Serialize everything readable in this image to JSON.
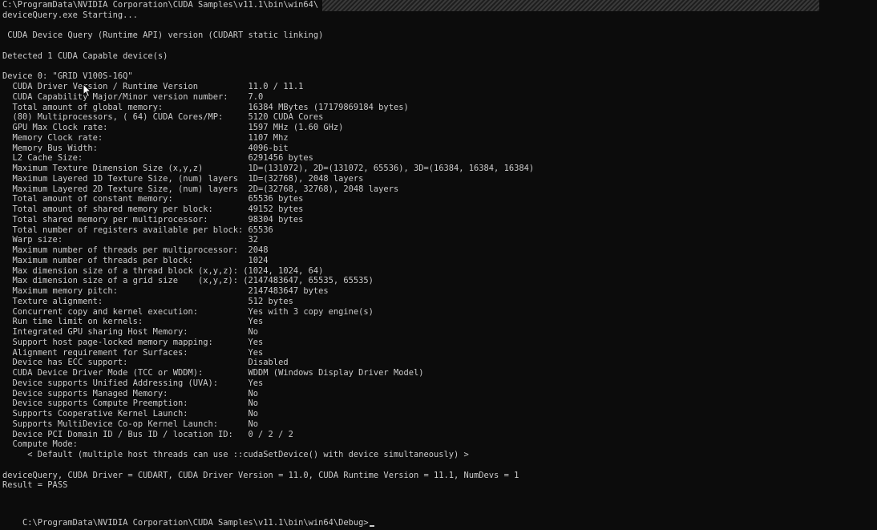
{
  "console": {
    "lines": [
      "C:\\ProgramData\\NVIDIA Corporation\\CUDA Samples\\v11.1\\bin\\win64\\",
      "deviceQuery.exe Starting...",
      "",
      " CUDA Device Query (Runtime API) version (CUDART static linking)",
      "",
      "Detected 1 CUDA Capable device(s)",
      "",
      "Device 0: \"GRID V100S-16Q\"",
      "  CUDA Driver Version / Runtime Version          11.0 / 11.1",
      "  CUDA Capability Major/Minor version number:    7.0",
      "  Total amount of global memory:                 16384 MBytes (17179869184 bytes)",
      "  (80) Multiprocessors, ( 64) CUDA Cores/MP:     5120 CUDA Cores",
      "  GPU Max Clock rate:                            1597 MHz (1.60 GHz)",
      "  Memory Clock rate:                             1107 Mhz",
      "  Memory Bus Width:                              4096-bit",
      "  L2 Cache Size:                                 6291456 bytes",
      "  Maximum Texture Dimension Size (x,y,z)         1D=(131072), 2D=(131072, 65536), 3D=(16384, 16384, 16384)",
      "  Maximum Layered 1D Texture Size, (num) layers  1D=(32768), 2048 layers",
      "  Maximum Layered 2D Texture Size, (num) layers  2D=(32768, 32768), 2048 layers",
      "  Total amount of constant memory:               65536 bytes",
      "  Total amount of shared memory per block:       49152 bytes",
      "  Total shared memory per multiprocessor:        98304 bytes",
      "  Total number of registers available per block: 65536",
      "  Warp size:                                     32",
      "  Maximum number of threads per multiprocessor:  2048",
      "  Maximum number of threads per block:           1024",
      "  Max dimension size of a thread block (x,y,z): (1024, 1024, 64)",
      "  Max dimension size of a grid size    (x,y,z): (2147483647, 65535, 65535)",
      "  Maximum memory pitch:                          2147483647 bytes",
      "  Texture alignment:                             512 bytes",
      "  Concurrent copy and kernel execution:          Yes with 3 copy engine(s)",
      "  Run time limit on kernels:                     Yes",
      "  Integrated GPU sharing Host Memory:            No",
      "  Support host page-locked memory mapping:       Yes",
      "  Alignment requirement for Surfaces:            Yes",
      "  Device has ECC support:                        Disabled",
      "  CUDA Device Driver Mode (TCC or WDDM):         WDDM (Windows Display Driver Model)",
      "  Device supports Unified Addressing (UVA):      Yes",
      "  Device supports Managed Memory:                No",
      "  Device supports Compute Preemption:            No",
      "  Supports Cooperative Kernel Launch:            No",
      "  Supports MultiDevice Co-op Kernel Launch:      No",
      "  Device PCI Domain ID / Bus ID / location ID:   0 / 2 / 2",
      "  Compute Mode:",
      "     < Default (multiple host threads can use ::cudaSetDevice() with device simultaneously) >",
      "",
      "deviceQuery, CUDA Driver = CUDART, CUDA Driver Version = 11.0, CUDA Runtime Version = 11.1, NumDevs = 1",
      "Result = PASS",
      ""
    ],
    "prompt": "C:\\ProgramData\\NVIDIA Corporation\\CUDA Samples\\v11.1\\bin\\win64\\Debug>"
  },
  "colors": {
    "background": "#0c0c0c",
    "text": "#cccccc"
  }
}
